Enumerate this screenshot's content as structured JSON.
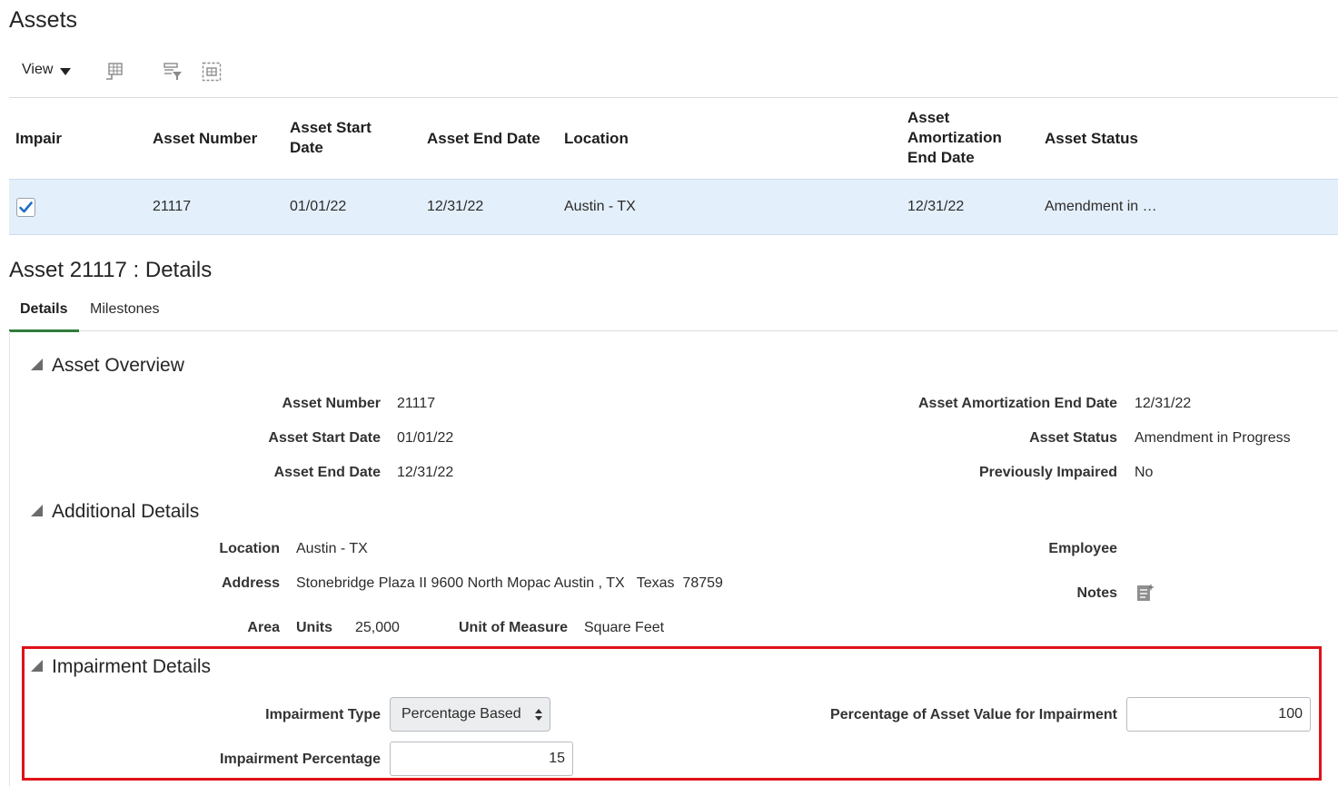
{
  "page": {
    "title": "Assets"
  },
  "toolbar": {
    "view_label": "View",
    "icons": [
      "freeze-columns-icon",
      "query-by-example-icon",
      "detach-icon"
    ]
  },
  "table": {
    "headers": {
      "impair": "Impair",
      "asset_number": "Asset Number",
      "asset_start_date_1": "Asset Start",
      "asset_start_date_2": "Date",
      "asset_end_date": "Asset End Date",
      "location": "Location",
      "amort_1": "Asset",
      "amort_2": "Amortization",
      "amort_3": "End Date",
      "asset_status": "Asset Status"
    },
    "rows": [
      {
        "impair": true,
        "asset_number": "21117",
        "asset_start_date": "01/01/22",
        "asset_end_date": "12/31/22",
        "location": "Austin - TX",
        "amortization_end_date": "12/31/22",
        "asset_status": "Amendment in …"
      }
    ]
  },
  "details": {
    "title": "Asset 21117 : Details",
    "tabs": [
      "Details",
      "Milestones"
    ],
    "active_tab": "Details",
    "overview": {
      "title": "Asset Overview",
      "asset_number_label": "Asset Number",
      "asset_number": "21117",
      "start_label": "Asset Start Date",
      "start": "01/01/22",
      "end_label": "Asset End Date",
      "end": "12/31/22",
      "amort_label": "Asset Amortization End Date",
      "amort": "12/31/22",
      "status_label": "Asset Status",
      "status": "Amendment in Progress",
      "prev_label": "Previously Impaired",
      "prev": "No"
    },
    "additional": {
      "title": "Additional Details",
      "location_label": "Location",
      "location": "Austin - TX",
      "address_label": "Address",
      "address": "Stonebridge Plaza II 9600 North Mopac Austin , TX   Texas  78759",
      "area_label": "Area",
      "units_label": "Units",
      "units": "25,000",
      "uom_label": "Unit of Measure",
      "uom": "Square Feet",
      "employee_label": "Employee",
      "notes_label": "Notes"
    },
    "impairment": {
      "title": "Impairment Details",
      "type_label": "Impairment Type",
      "type_value": "Percentage Based",
      "pct_label": "Impairment Percentage",
      "pct_value": "15",
      "asset_pct_label": "Percentage of Asset Value for Impairment",
      "asset_pct_value": "100"
    }
  },
  "colors": {
    "selected_row": "#e3effa",
    "highlight_border": "#e0121b",
    "tab_underline": "#2f7d3a",
    "checkbox": "#1f6fc5"
  }
}
